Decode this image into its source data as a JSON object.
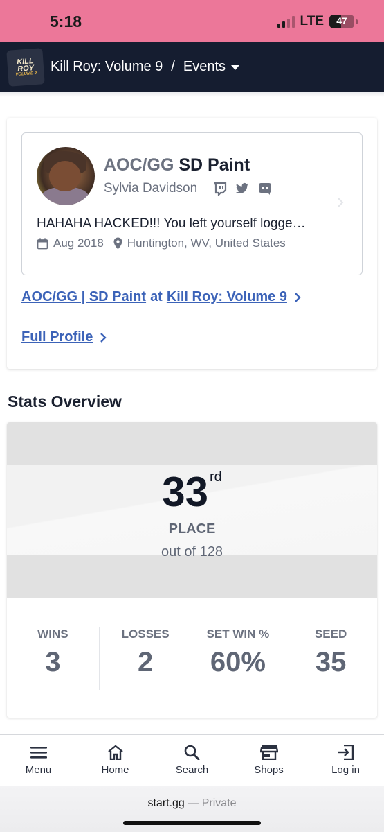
{
  "status_bar": {
    "time": "5:18",
    "network": "LTE",
    "battery": "47",
    "battery_level": 0.47
  },
  "header": {
    "event_title": "Kill Roy: Volume 9",
    "separator": "/",
    "section": "Events",
    "logo_lines": [
      "KILL",
      "ROY",
      "VOLUME 9"
    ]
  },
  "profile": {
    "prefix": "AOC/GG",
    "gamertag": "SD Paint",
    "real_name": "Sylvia Davidson",
    "social_icons": [
      "twitch-icon",
      "twitter-icon",
      "discord-icon"
    ],
    "bio": "HAHAHA HACKED!!! You left yourself logge…",
    "joined": "Aug 2018",
    "location": "Huntington, WV, United States",
    "entrant_link": {
      "entrant": "AOC/GG | SD Paint",
      "at": "at",
      "event": "Kill Roy: Volume 9"
    },
    "full_profile_label": "Full Profile"
  },
  "stats": {
    "title": "Stats Overview",
    "placement": "33",
    "placement_suffix": "rd",
    "place_label": "PLACE",
    "out_of": "out of 128",
    "columns": [
      {
        "label": "WINS",
        "value": "3"
      },
      {
        "label": "LOSSES",
        "value": "2"
      },
      {
        "label": "SET WIN %",
        "value": "60%"
      },
      {
        "label": "SEED",
        "value": "35"
      }
    ]
  },
  "tabbar": {
    "items": [
      {
        "label": "Menu",
        "icon": "menu-icon"
      },
      {
        "label": "Home",
        "icon": "home-icon"
      },
      {
        "label": "Search",
        "icon": "search-icon"
      },
      {
        "label": "Shops",
        "icon": "shop-icon"
      },
      {
        "label": "Log in",
        "icon": "login-icon"
      }
    ]
  },
  "browser": {
    "domain": "start.gg",
    "dash": "—",
    "mode": "Private"
  },
  "colors": {
    "status_bar": "#ec7799",
    "header": "#151d30",
    "link": "#3c63b8"
  }
}
